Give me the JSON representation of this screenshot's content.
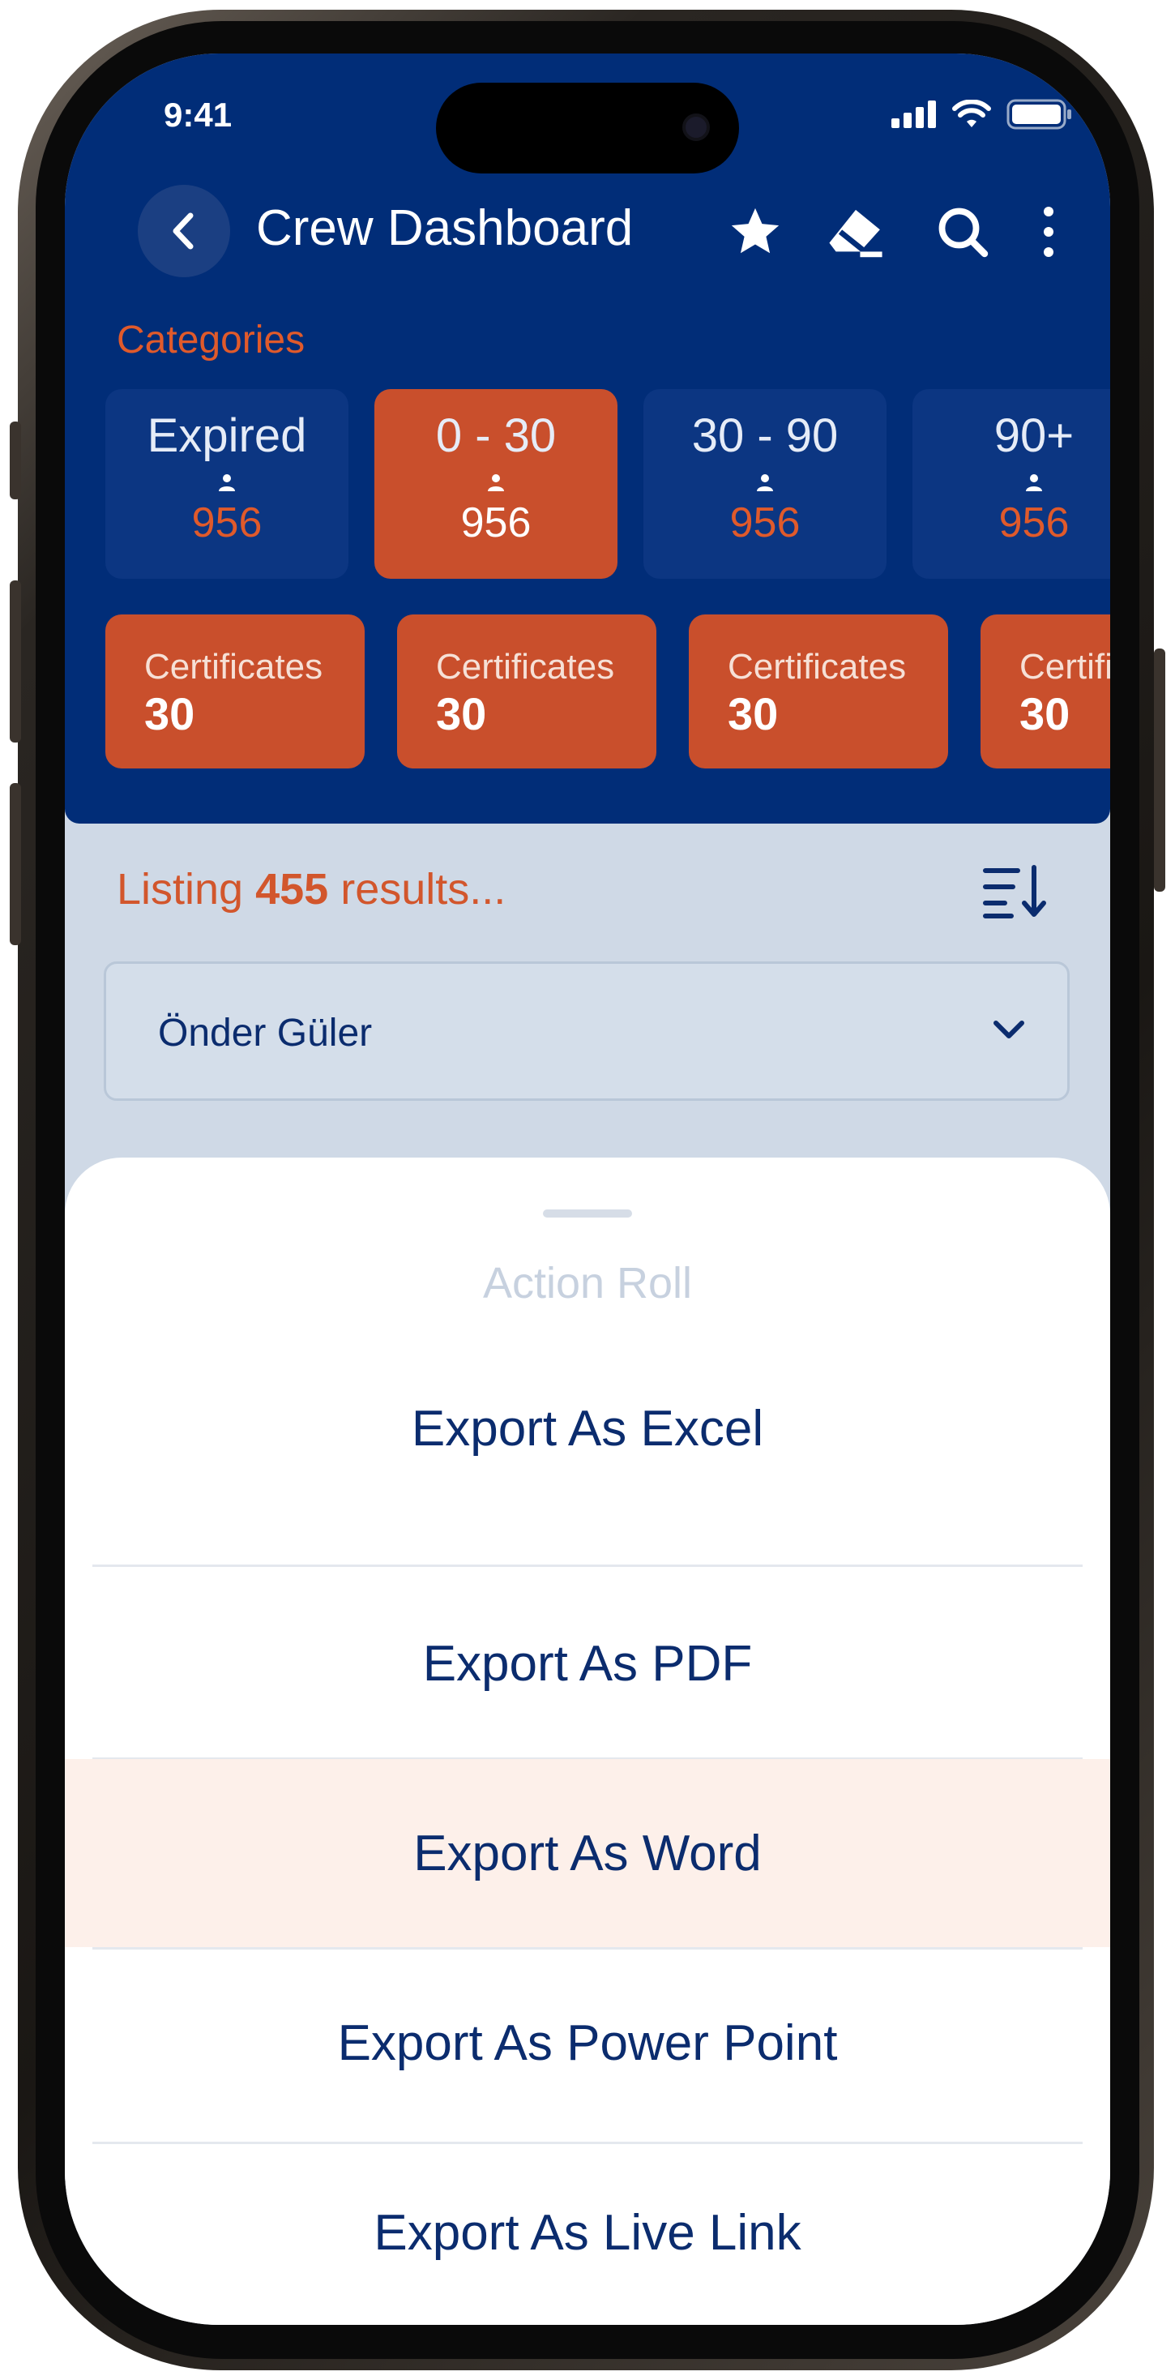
{
  "status_bar": {
    "time": "9:41"
  },
  "header": {
    "title": "Crew Dashboard"
  },
  "categories": {
    "label": "Categories",
    "items": [
      {
        "label": "Expired",
        "count": "956",
        "active": false
      },
      {
        "label": "0 - 30",
        "count": "956",
        "active": true
      },
      {
        "label": "30 - 90",
        "count": "956",
        "active": false
      },
      {
        "label": "90+",
        "count": "956",
        "active": false
      }
    ]
  },
  "certificates": [
    {
      "label": "Certificates",
      "value": "30"
    },
    {
      "label": "Certificates",
      "value": "30"
    },
    {
      "label": "Certificates",
      "value": "30"
    },
    {
      "label": "Certificates",
      "value": "30"
    }
  ],
  "listing": {
    "prefix": "Listing ",
    "count": "455",
    "suffix": " results..."
  },
  "filter": {
    "selected": "Önder Güler"
  },
  "action_sheet": {
    "title": "Action Roll",
    "actions": [
      {
        "label": "Export As Excel",
        "highlighted": false
      },
      {
        "label": "Export As PDF",
        "highlighted": false
      },
      {
        "label": "Export As Word",
        "highlighted": true
      },
      {
        "label": "Export As Power Point",
        "highlighted": false
      },
      {
        "label": "Export As Live Link",
        "highlighted": false
      }
    ]
  },
  "colors": {
    "primary": "#012d78",
    "accent": "#c94f2c",
    "highlight": "#fdf0ea"
  }
}
